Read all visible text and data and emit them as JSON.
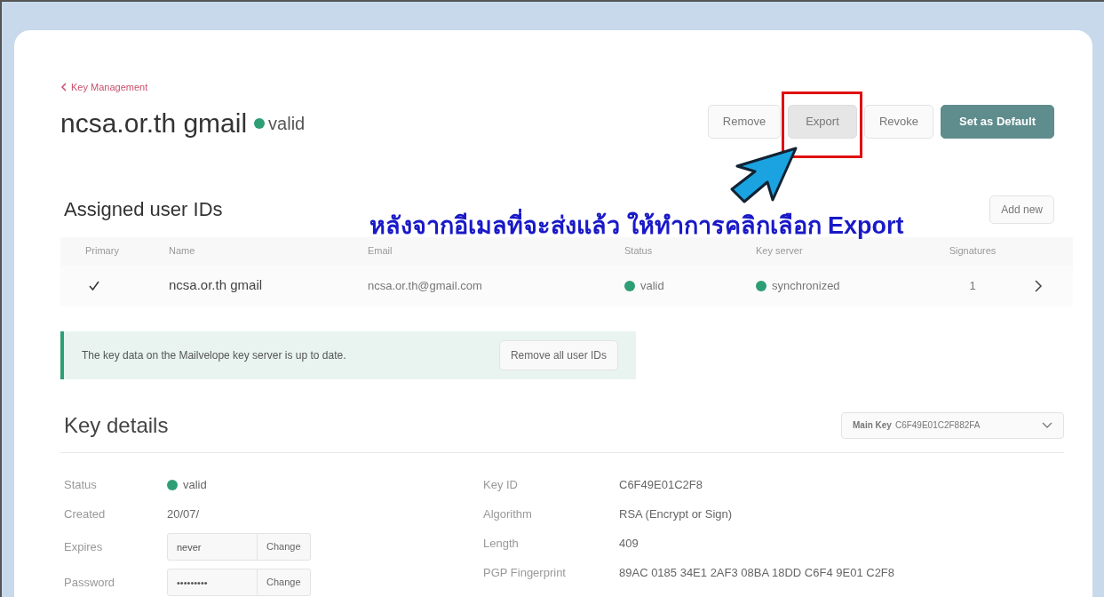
{
  "breadcrumb": "Key Management",
  "title": "ncsa.or.th gmail",
  "status": "valid",
  "actions": [
    {
      "label": "Remove",
      "kind": "default"
    },
    {
      "label": "Export",
      "kind": "highlighted"
    },
    {
      "label": "Revoke",
      "kind": "default"
    },
    {
      "label": "Set as Default",
      "kind": "primary"
    }
  ],
  "annotation": {
    "caption": "หลังจากอีเมลที่จะส่งแล้ว ให้ทำการคลิกเลือก Export"
  },
  "user_ids": {
    "title": "Assigned user IDs",
    "add_button": "Add new",
    "columns": [
      "Primary",
      "Name",
      "Email",
      "Status",
      "Key server",
      "Signatures"
    ],
    "rows": [
      {
        "primary": true,
        "name": "ncsa.or.th gmail",
        "email": "ncsa.or.th@gmail.com",
        "status": "valid",
        "key_server": "synchronized",
        "signatures": "1"
      }
    ]
  },
  "notice": {
    "text": "The key data on the Mailvelope key server is up to date.",
    "button": "Remove all user IDs"
  },
  "key_details": {
    "title": "Key details",
    "key_select": {
      "label": "Main Key",
      "value": "C6F49E01C2F882FA"
    },
    "left": [
      {
        "label": "Status",
        "kind": "status",
        "value": "valid"
      },
      {
        "label": "Created",
        "kind": "text",
        "value": "20/07/"
      },
      {
        "label": "Expires",
        "kind": "field",
        "value": "never",
        "button": "Change"
      },
      {
        "label": "Password",
        "kind": "field",
        "value": "•••••••••",
        "button": "Change"
      }
    ],
    "right": [
      {
        "label": "Key ID",
        "value": "C6F49E01C2F8"
      },
      {
        "label": "Algorithm",
        "value": "RSA (Encrypt or Sign)"
      },
      {
        "label": "Length",
        "value": "409"
      },
      {
        "label": "PGP Fingerprint",
        "value": "89AC 0185 34E1 2AF3 08BA 18DD C6F4 9E01 C2F8"
      }
    ]
  }
}
